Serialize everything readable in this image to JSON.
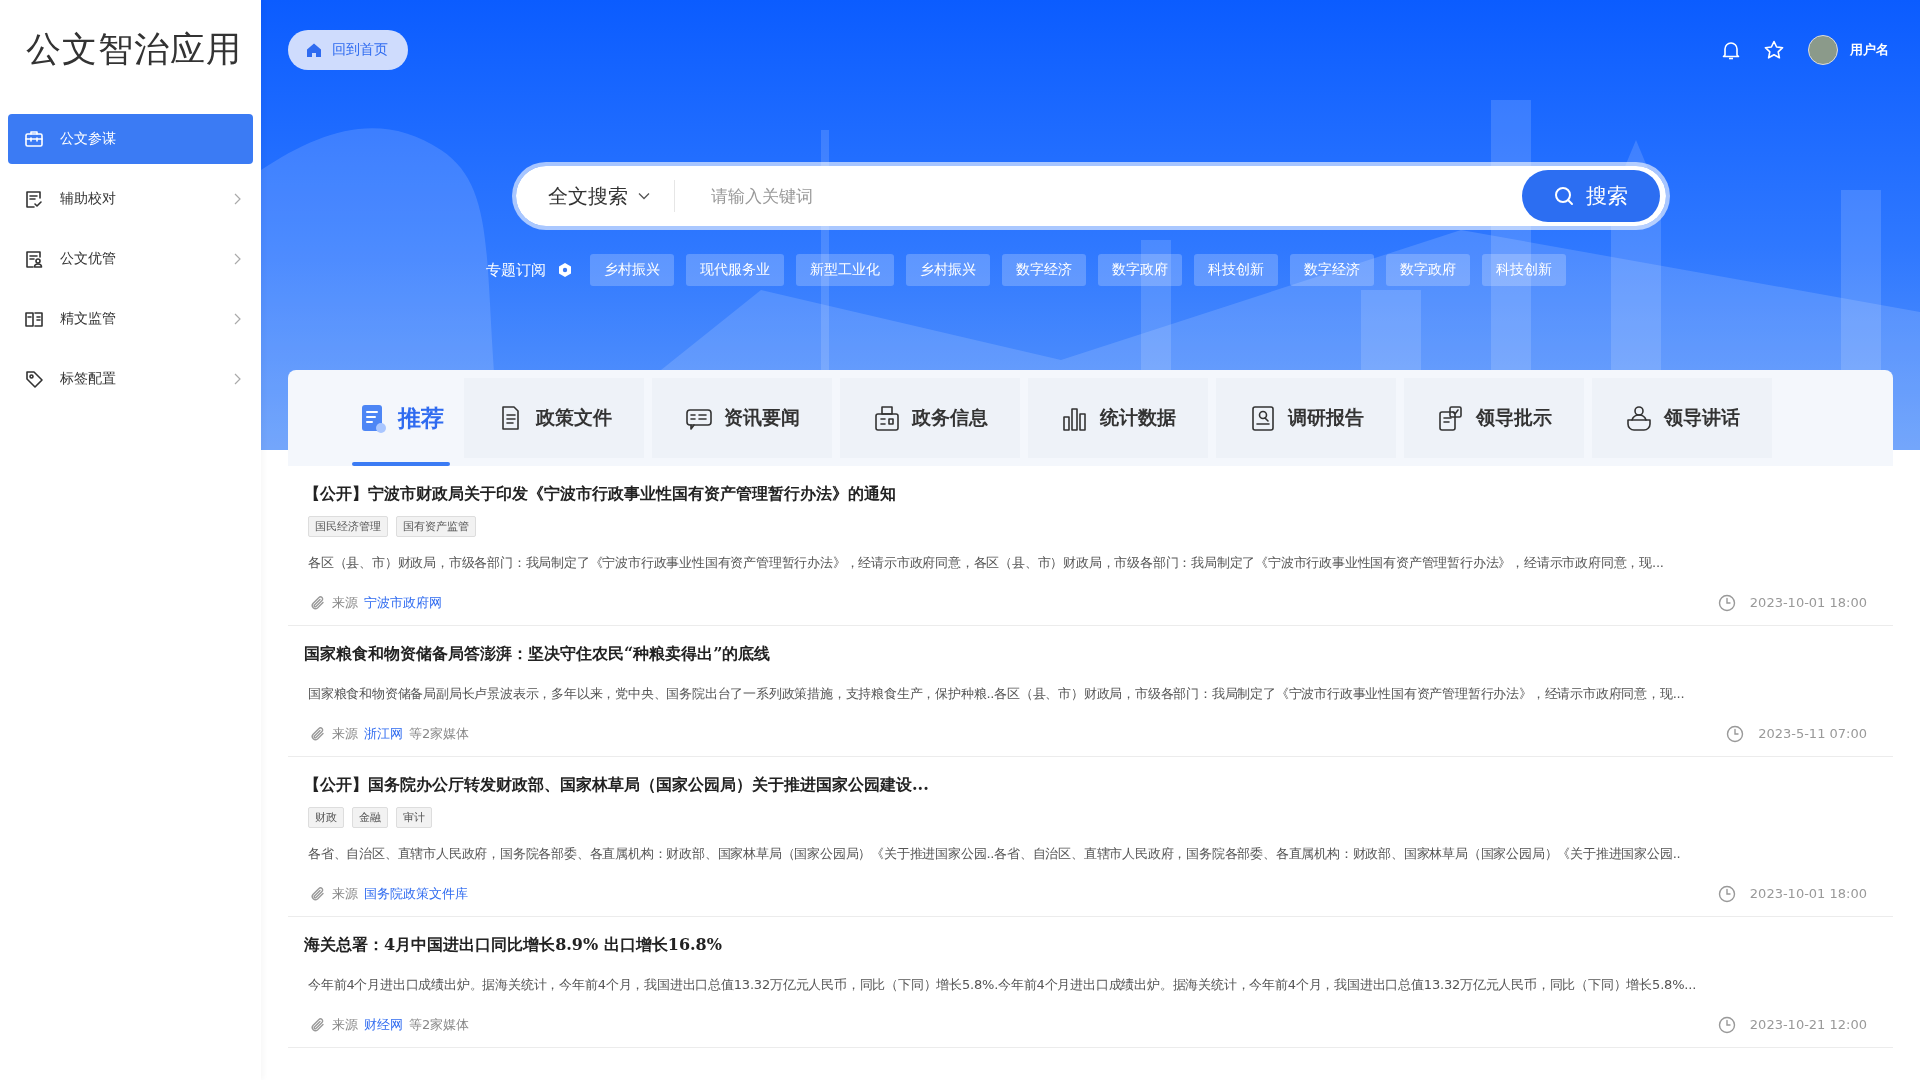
{
  "app_title": "公文智治应用",
  "sidebar": {
    "items": [
      {
        "label": "公文参谋",
        "selected": true,
        "expandable": false
      },
      {
        "label": "辅助校对",
        "selected": false,
        "expandable": true
      },
      {
        "label": "公文优管",
        "selected": false,
        "expandable": true
      },
      {
        "label": "精文监管",
        "selected": false,
        "expandable": true
      },
      {
        "label": "标签配置",
        "selected": false,
        "expandable": true
      }
    ]
  },
  "header": {
    "home_button": "回到首页",
    "user_name": "用户名"
  },
  "search": {
    "scope": "全文搜索",
    "placeholder": "请输入关键词",
    "button": "搜索"
  },
  "subscriptions": {
    "label": "专题订阅",
    "topics": [
      "乡村振兴",
      "现代服务业",
      "新型工业化",
      "乡村振兴",
      "数字经济",
      "数字政府",
      "科技创新",
      "数字经济",
      "数字政府",
      "科技创新"
    ]
  },
  "tabs": [
    {
      "label": "推荐",
      "selected": true
    },
    {
      "label": "政策文件",
      "selected": false
    },
    {
      "label": "资讯要闻",
      "selected": false
    },
    {
      "label": "政务信息",
      "selected": false
    },
    {
      "label": "统计数据",
      "selected": false
    },
    {
      "label": "调研报告",
      "selected": false
    },
    {
      "label": "领导批示",
      "selected": false
    },
    {
      "label": "领导讲话",
      "selected": false
    }
  ],
  "articles": [
    {
      "title": "【公开】宁波市财政局关于印发《宁波市行政事业性国有资产管理暂行办法》的通知",
      "tags": [
        "国民经济管理",
        "国有资产监管"
      ],
      "summary": "各区（县、市）财政局，市级各部门：我局制定了《宁波市行政事业性国有资产管理暂行办法》，经请示市政府同意，各区（县、市）财政局，市级各部门：我局制定了《宁波市行政事业性国有资产管理暂行办法》，经请示市政府同意，现...",
      "source_label": "来源",
      "source": "宁波市政府网",
      "time": "2023-10-01 18:00"
    },
    {
      "title": "国家粮食和物资储备局答澎湃：坚决守住农民“种粮卖得出”的底线",
      "summary": "国家粮食和物资储备局副局长卢景波表示，多年以来，党中央、国务院出台了一系列政策措施，支持粮食生产，保护种粮..各区（县、市）财政局，市级各部门：我局制定了《宁波市行政事业性国有资产管理暂行办法》，经请示市政府同意，现...",
      "source_label": "来源",
      "source": "浙江网",
      "extra": "等2家媒体",
      "time": "2023-5-11 07:00"
    },
    {
      "title": "【公开】国务院办公厅转发财政部、国家林草局（国家公园局）关于推进国家公园建设...",
      "tags": [
        "财政",
        "金融",
        "审计"
      ],
      "summary": "各省、自治区、直辖市人民政府，国务院各部委、各直属机构：财政部、国家林草局（国家公园局）《关于推进国家公园..各省、自治区、直辖市人民政府，国务院各部委、各直属机构：财政部、国家林草局（国家公园局）《关于推进国家公园..",
      "source_label": "来源",
      "source": "国务院政策文件库",
      "time": "2023-10-01 18:00"
    },
    {
      "title": "海关总署：4月中国进出口同比增长8.9% 出口增长16.8%",
      "summary": "今年前4个月进出口成绩出炉。据海关统计，今年前4个月，我国进出口总值13.32万亿元人民币，同比（下同）增长5.8%.今年前4个月进出口成绩出炉。据海关统计，今年前4个月，我国进出口总值13.32万亿元人民币，同比（下同）增长5.8%...",
      "source_label": "来源",
      "source": "财经网",
      "extra": "等2家媒体",
      "time": "2023-10-21 12:00"
    }
  ]
}
